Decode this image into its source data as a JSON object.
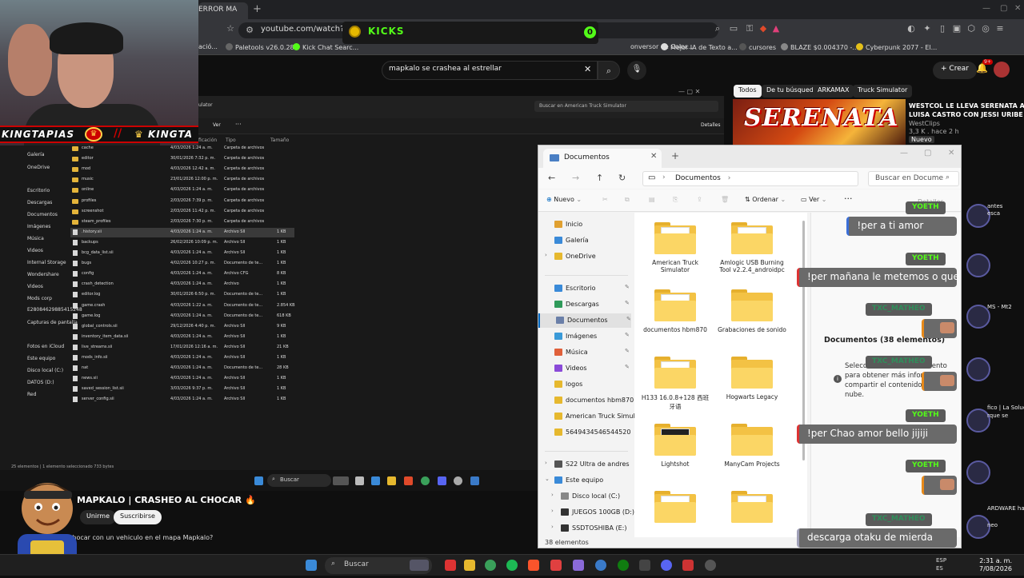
{
  "browser": {
    "tab_title": "ERROR MA",
    "url": "youtube.com/watch?v=",
    "bookmarks": [
      "ació...",
      "Paletools v26.0.28",
      "Kick Chat Searc...",
      "onversor de Color...",
      "Mejor IA de Texto a...",
      "cursores",
      "BLAZE $0.004370 -...",
      "Cyberpunk 2077 - El..."
    ]
  },
  "kicks": {
    "label": "KICKS",
    "count": "0"
  },
  "youtube": {
    "search_query": "mapkalo se crashea al estrellar",
    "create_label": "Crear",
    "bell_badge": "9+",
    "chips": [
      "Todos",
      "De tu búsqueda",
      "ARKAMAX",
      "Truck Simulator"
    ],
    "rec": {
      "thumb_text": "SERENATA",
      "title1": "WESTCOL LE LLEVA SERENATA A",
      "title2": "LUISA CASTRO CON JESSI URIBE",
      "channel": "WestClips",
      "meta": "3,3 K . hace 2 h",
      "badge": "Nuevo"
    },
    "video_title": "MAPKALO | CRASHEO AL CHOCAR",
    "join_label": "Unirme",
    "subscribe_label": "Suscribirse",
    "description": "chocar con un vehiculo en el mapa Mapkalo?"
  },
  "sidebar_right": [
    "antes",
    "esca",
    "MS - Mt2",
    "fico | La Solución",
    "rque se",
    "ARDWARE ha",
    "neo"
  ],
  "streamer": {
    "name_left": "KINGTAPIAS",
    "name_right": "KINGTA"
  },
  "dark_explorer": {
    "breadcrumb": "ulator",
    "search_placeholder": "Buscar en American Truck Simulator",
    "view_label": "Ver",
    "details_label": "Detalles",
    "headers": [
      "ficación",
      "Tipo",
      "Tamaño"
    ],
    "sidebar": [
      "Galería",
      "OneDrive",
      "Escritorio",
      "Descargas",
      "Documentos",
      "Imágenes",
      "Música",
      "Videos",
      "Internal Storage",
      "Wondershare",
      "Videos",
      "Mods corp",
      "E28084629885415248",
      "Capturas de pantalla",
      "Fotos en iCloud",
      "Este equipo",
      "Disco local (C:)",
      "DATOS (D:)",
      "Red"
    ],
    "rows": [
      {
        "name": "cache",
        "date": "4/03/2026 1:24 a. m.",
        "type": "Carpeta de archivos",
        "size": "",
        "kind": "folder"
      },
      {
        "name": "editor",
        "date": "30/01/2026 7:32 p. m.",
        "type": "Carpeta de archivos",
        "size": "",
        "kind": "folder"
      },
      {
        "name": "mod",
        "date": "4/03/2026 12:42 a. m.",
        "type": "Carpeta de archivos",
        "size": "",
        "kind": "folder"
      },
      {
        "name": "music",
        "date": "23/01/2026 12:00 p. m.",
        "type": "Carpeta de archivos",
        "size": "",
        "kind": "folder"
      },
      {
        "name": "online",
        "date": "4/03/2026 1:24 a. m.",
        "type": "Carpeta de archivos",
        "size": "",
        "kind": "folder"
      },
      {
        "name": "profiles",
        "date": "2/03/2026 7:39 p. m.",
        "type": "Carpeta de archivos",
        "size": "",
        "kind": "folder"
      },
      {
        "name": "screenshot",
        "date": "2/03/2026 11:42 p. m.",
        "type": "Carpeta de archivos",
        "size": "",
        "kind": "folder"
      },
      {
        "name": "steam_profiles",
        "date": "2/03/2026 7:30 p. m.",
        "type": "Carpeta de archivos",
        "size": "",
        "kind": "folder"
      },
      {
        "name": ".history.sii",
        "date": "4/03/2026 1:24 a. m.",
        "type": "Archivo SII",
        "size": "1 KB",
        "kind": "file"
      },
      {
        "name": "backups",
        "date": "26/02/2026 10:09 p. m.",
        "type": "Archivo SII",
        "size": "1 KB",
        "kind": "file"
      },
      {
        "name": "bcg_data_list.sii",
        "date": "4/03/2026 1:24 a. m.",
        "type": "Archivo SII",
        "size": "1 KB",
        "kind": "file"
      },
      {
        "name": "bugs",
        "date": "4/02/2026 10:27 p. m.",
        "type": "Documento de te...",
        "size": "1 KB",
        "kind": "file"
      },
      {
        "name": "config",
        "date": "4/03/2026 1:24 a. m.",
        "type": "Archivo CFG",
        "size": "8 KB",
        "kind": "file"
      },
      {
        "name": "crash_detection",
        "date": "4/03/2026 1:24 a. m.",
        "type": "Archivo",
        "size": "1 KB",
        "kind": "file"
      },
      {
        "name": "editor.log",
        "date": "30/01/2026 6:50 p. m.",
        "type": "Documento de te...",
        "size": "1 KB",
        "kind": "file"
      },
      {
        "name": "game.crash",
        "date": "4/03/2026 1:22 a. m.",
        "type": "Documento de te...",
        "size": "2.854 KB",
        "kind": "file"
      },
      {
        "name": "game.log",
        "date": "4/03/2026 1:24 a. m.",
        "type": "Documento de te...",
        "size": "618 KB",
        "kind": "file"
      },
      {
        "name": "global_controls.sii",
        "date": "29/12/2026 4:40 p. m.",
        "type": "Archivo SII",
        "size": "9 KB",
        "kind": "file"
      },
      {
        "name": "inventory_item_data.sii",
        "date": "4/03/2026 1:24 a. m.",
        "type": "Archivo SII",
        "size": "1 KB",
        "kind": "file"
      },
      {
        "name": "live_streams.sii",
        "date": "17/01/2026 12:16 a. m.",
        "type": "Archivo SII",
        "size": "21 KB",
        "kind": "file"
      },
      {
        "name": "mods_info.sii",
        "date": "4/03/2026 1:24 a. m.",
        "type": "Archivo SII",
        "size": "1 KB",
        "kind": "file"
      },
      {
        "name": "nat",
        "date": "4/03/2026 1:24 a. m.",
        "type": "Documento de te...",
        "size": "28 KB",
        "kind": "file"
      },
      {
        "name": "news.sii",
        "date": "4/03/2026 1:24 a. m.",
        "type": "Archivo SII",
        "size": "1 KB",
        "kind": "file"
      },
      {
        "name": "saved_session_list.sii",
        "date": "3/03/2026 9:37 p. m.",
        "type": "Archivo SII",
        "size": "1 KB",
        "kind": "file"
      },
      {
        "name": "server_config.sii",
        "date": "4/03/2026 1:24 a. m.",
        "type": "Archivo SII",
        "size": "1 KB",
        "kind": "file"
      }
    ],
    "status": "25 elementos  |  1 elemento seleccionado  733 bytes",
    "overlay_search": "Buscar"
  },
  "explorer": {
    "tab_title": "Documentos",
    "breadcrumb": "Documentos",
    "search_placeholder": "Buscar en Docume",
    "cmd_new": "Nuevo",
    "cmd_sort": "Ordenar",
    "cmd_view": "Ver",
    "cmd_more": "···",
    "cmd_details": "Detalles",
    "nav": [
      {
        "label": "Inicio",
        "color": "#e0a030",
        "pin": false,
        "expand": false
      },
      {
        "label": "Galería",
        "color": "#3a8ad8",
        "pin": false,
        "expand": false
      },
      {
        "label": "OneDrive",
        "color": "#e6b82e",
        "pin": false,
        "expand": true
      },
      {
        "label": "Escritorio",
        "color": "#3a8ad8",
        "pin": true,
        "expand": false
      },
      {
        "label": "Descargas",
        "color": "#2f9a5a",
        "pin": true,
        "expand": false
      },
      {
        "label": "Documentos",
        "color": "#6a7fa8",
        "pin": true,
        "expand": false
      },
      {
        "label": "Imágenes",
        "color": "#3a9ad8",
        "pin": true,
        "expand": false
      },
      {
        "label": "Música",
        "color": "#e0603a",
        "pin": true,
        "expand": false
      },
      {
        "label": "Videos",
        "color": "#8a4ad8",
        "pin": true,
        "expand": false
      },
      {
        "label": "logos",
        "color": "#e6b82e",
        "pin": false,
        "expand": false
      },
      {
        "label": "documentos hbm870",
        "color": "#e6b82e",
        "pin": false,
        "expand": false
      },
      {
        "label": "American Truck Simulato",
        "color": "#e6b82e",
        "pin": false,
        "expand": false
      },
      {
        "label": "5649434546544520",
        "color": "#e6b82e",
        "pin": false,
        "expand": false
      },
      {
        "label": "S22 Ultra de andres",
        "color": "#555",
        "pin": false,
        "expand": true
      },
      {
        "label": "Este equipo",
        "color": "#3a8ad8",
        "pin": false,
        "expand": true
      },
      {
        "label": "Disco local (C:)",
        "color": "#888",
        "pin": false,
        "expand": true
      },
      {
        "label": "JUEGOS 100GB (D:)",
        "color": "#333",
        "pin": false,
        "expand": true
      },
      {
        "label": "SSDTOSHIBA (E:)",
        "color": "#333",
        "pin": false,
        "expand": true
      }
    ],
    "files": [
      {
        "name": "American Truck Simulator",
        "paper": true
      },
      {
        "name": "Amlogic USB Burning Tool v2.2.4_androidpc",
        "paper": true
      },
      {
        "name": "documentos hbm870",
        "paper": true
      },
      {
        "name": "Grabaciones de sonido",
        "paper": false
      },
      {
        "name": "H133 16.0.8+128 西班牙语",
        "paper": true
      },
      {
        "name": "Hogwarts Legacy",
        "paper": false
      },
      {
        "name": "Lightshot",
        "paper": true
      },
      {
        "name": "ManyCam Projects",
        "paper": false
      },
      {
        "name": "",
        "paper": true
      },
      {
        "name": "",
        "paper": true
      }
    ],
    "details_title": "Documentos (38 elementos)",
    "details_body": "Seleccione un único elemento para obtener más información y compartir el contenido en la nube.",
    "status": "38 elementos"
  },
  "chat": [
    {
      "user": "YOETH",
      "msg": "!per a ti amor",
      "style": "blue"
    },
    {
      "user": "YOETH",
      "msg": "!per mañana le metemos o que",
      "style": "red"
    },
    {
      "user": "TXC_MATHEO",
      "msg": "",
      "style": "orange"
    },
    {
      "user": "TXC_MATHEO",
      "msg": "",
      "style": "orange"
    },
    {
      "user": "YOETH",
      "msg": "!per Chao amor bello jijiji",
      "style": "red"
    },
    {
      "user": "YOETH",
      "msg": "",
      "style": "orange"
    },
    {
      "user": "TXC_MATHEO",
      "msg": "descarga otaku de mierda",
      "style": "grey"
    }
  ],
  "taskbar": {
    "search_placeholder": "Buscar",
    "lang1": "ESP",
    "lang2": "ES",
    "time": "2:31 a. m.",
    "date": "7/08/2026"
  }
}
